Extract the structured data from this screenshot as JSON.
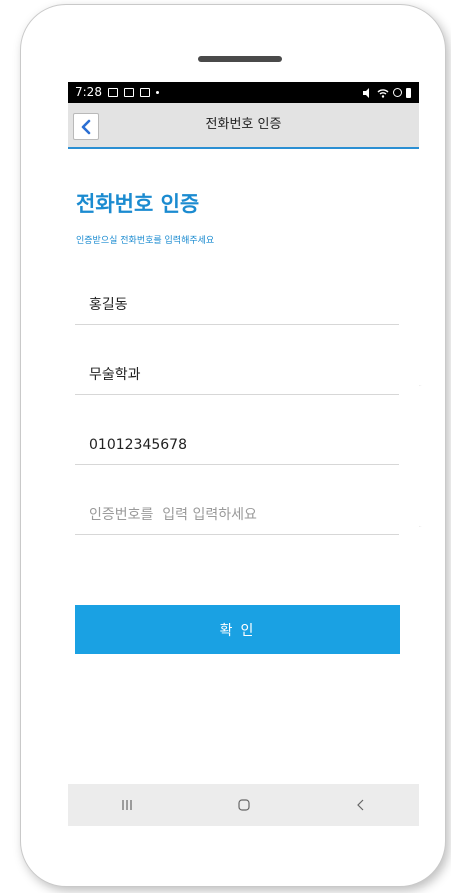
{
  "status_bar": {
    "time": "7:28"
  },
  "app_bar": {
    "title": "전화번호 인증"
  },
  "page": {
    "heading": "전화번호 인증",
    "subtitle": "인증받으실 전화번호를 입력해주세요"
  },
  "form": {
    "name_value": "홍길동",
    "department_value": "무술학과",
    "phone_value": "01012345678",
    "code_placeholder": "인증번호를  입력 입력하세요"
  },
  "confirm_label": "확 인",
  "colors": {
    "accent": "#1aa1e3",
    "heading": "#1b8bd0",
    "appbar_bg": "#e3e3e3",
    "navbar_bg": "#ececec"
  },
  "nav_icons": [
    "recent-apps-icon",
    "home-icon",
    "back-nav-icon"
  ]
}
